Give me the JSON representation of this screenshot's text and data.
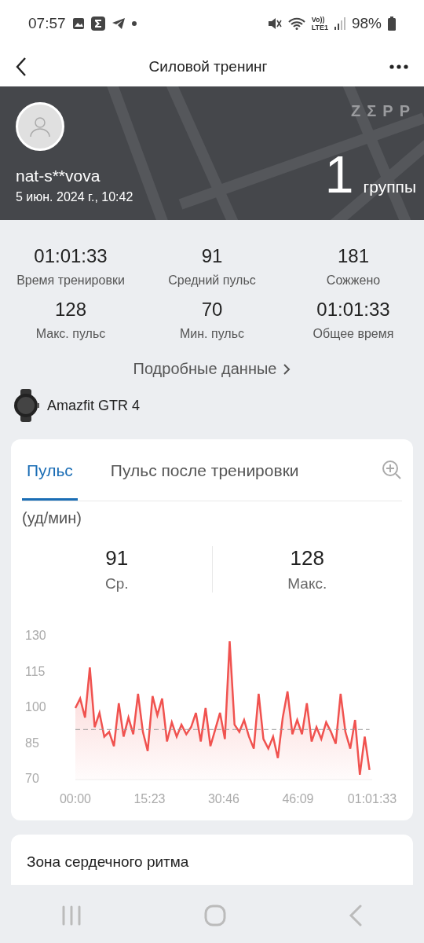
{
  "status_bar": {
    "time": "07:57",
    "volte": "Vo))",
    "network": "LTE1",
    "battery": "98%"
  },
  "app_bar": {
    "title": "Силовой тренинг"
  },
  "header": {
    "logo": "ZΣPP",
    "user": "nat-s**vova",
    "date": "5 июн. 2024 г., 10:42",
    "count": "1",
    "count_unit": "группы"
  },
  "stats": [
    {
      "value": "01:01:33",
      "label": "Время тренировки"
    },
    {
      "value": "91",
      "label": "Средний пульс"
    },
    {
      "value": "181",
      "label": "Сожжено"
    },
    {
      "value": "128",
      "label": "Макс. пульс"
    },
    {
      "value": "70",
      "label": "Мин. пульс"
    },
    {
      "value": "01:01:33",
      "label": "Общее время"
    }
  ],
  "details_link": "Подробные данные",
  "device": {
    "name": "Amazfit GTR 4"
  },
  "heart_card": {
    "tabs": [
      {
        "label": "Пульс",
        "selected": true
      },
      {
        "label": "Пульс после тренировки",
        "selected": false
      }
    ],
    "unit": "(уд/мин)",
    "summary": [
      {
        "value": "91",
        "label": "Ср."
      },
      {
        "value": "128",
        "label": "Макс."
      }
    ],
    "chart_data": {
      "type": "area",
      "x": [
        0,
        1,
        2,
        3,
        4,
        5,
        6,
        7,
        8,
        9,
        10,
        11,
        12,
        13,
        14,
        15,
        16,
        17,
        18,
        19,
        20,
        21,
        22,
        23,
        24,
        25,
        26,
        27,
        28,
        29,
        30,
        31,
        32,
        33,
        34,
        35,
        36,
        37,
        38,
        39,
        40,
        41,
        42,
        43,
        44,
        45,
        46,
        47,
        48,
        49,
        50,
        51,
        52,
        53,
        54,
        55,
        56,
        57,
        58,
        59,
        60,
        61
      ],
      "series": [
        {
          "color": "#f0524f",
          "values": [
            100,
            104,
            96,
            117,
            92,
            98,
            88,
            90,
            84,
            102,
            88,
            96,
            89,
            106,
            90,
            82,
            105,
            97,
            104,
            86,
            94,
            88,
            93,
            89,
            92,
            98,
            86,
            100,
            84,
            91,
            98,
            87,
            128,
            93,
            90,
            95,
            88,
            83,
            106,
            87,
            83,
            88,
            79,
            96,
            107,
            89,
            95,
            89,
            102,
            86,
            92,
            87,
            94,
            90,
            85,
            106,
            90,
            83,
            95,
            72,
            88,
            74
          ]
        },
        {
          "type": "line",
          "line_style": "dashed",
          "color": "#999999",
          "values": [
            91,
            91,
            91,
            91,
            91,
            91,
            91,
            91,
            91,
            91,
            91,
            91,
            91,
            91,
            91,
            91,
            91,
            91,
            91,
            91,
            91,
            91,
            91,
            91,
            91,
            91,
            91,
            91,
            91,
            91,
            91,
            91,
            91,
            91,
            91,
            91,
            91,
            91,
            91,
            91,
            91,
            91,
            91,
            91,
            91,
            91,
            91,
            91,
            91,
            91,
            91,
            91,
            91,
            91,
            91,
            91,
            91,
            91,
            91,
            91,
            91,
            91
          ]
        }
      ],
      "xlim": [
        0,
        61.55
      ],
      "ylim": [
        70,
        130
      ],
      "xticks": [
        {
          "value": 0,
          "label": "00:00"
        },
        {
          "value": 15.38,
          "label": "15:23"
        },
        {
          "value": 30.77,
          "label": "30:46"
        },
        {
          "value": 46.15,
          "label": "46:09"
        },
        {
          "value": 61.55,
          "label": "01:01:33"
        }
      ],
      "yticks": [
        130,
        115,
        100,
        85,
        70
      ]
    }
  },
  "next_card": {
    "title": "Зона сердечного ритма"
  }
}
